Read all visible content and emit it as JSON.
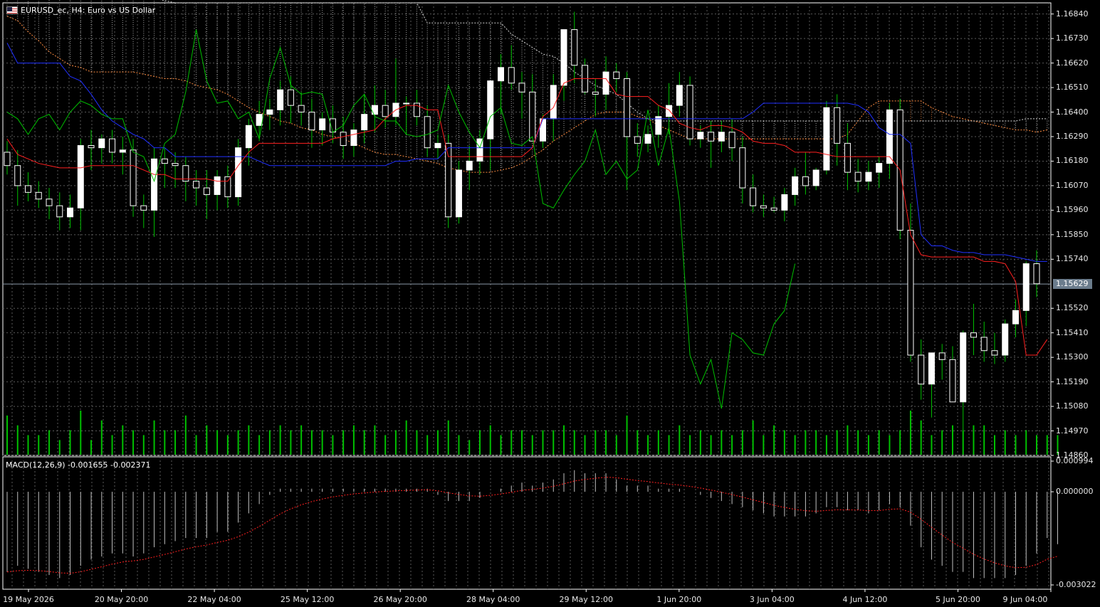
{
  "window": {
    "title": "EURUSD_ec, H4:  Euro vs US Dollar",
    "flag_icon": "us-eu-flag-icon"
  },
  "colors": {
    "background": "#000000",
    "grid": "#5a5a5a",
    "axis": "#ffffff",
    "bull_candle": "#ffffff",
    "bear_candle": "#000000",
    "wick": "#00c000",
    "tenkan": "#ff2020",
    "kijun": "#2030ff",
    "chikou": "#00c000",
    "span_a": "#ff8c40",
    "span_b": "#d8d8d8",
    "volume": "#00c000",
    "macd_hist": "#c0c0c0",
    "macd_signal": "#ff2020",
    "current_price_bg": "#6b7c8c"
  },
  "price_axis": {
    "labels": [
      "1.16840",
      "1.16730",
      "1.16620",
      "1.16510",
      "1.16400",
      "1.16290",
      "1.16180",
      "1.16070",
      "1.15960",
      "1.15850",
      "1.15740",
      "1.15520",
      "1.15410",
      "1.15300",
      "1.15190",
      "1.15080",
      "1.14970",
      "1.14860"
    ],
    "current_price": "1.15629"
  },
  "macd": {
    "label": "MACD(12,26,9) -0.001655 -0.002371",
    "axis_labels": [
      "0.000994",
      "0.000000",
      "-0.003022"
    ]
  },
  "time_axis": {
    "labels": [
      "19 May 2026",
      "20 May 20:00",
      "22 May 04:00",
      "25 May 12:00",
      "26 May 20:00",
      "28 May 04:00",
      "29 May 12:00",
      "1 Jun 20:00",
      "3 Jun 04:00",
      "4 Jun 12:00",
      "5 Jun 20:00",
      "9 Jun 04:00"
    ]
  },
  "chart_data": {
    "type": "candlestick",
    "symbol": "EURUSD_ec",
    "timeframe": "H4",
    "ylim": [
      1.1486,
      1.1689
    ],
    "macd_ylim": [
      -0.003022,
      0.000994
    ],
    "candles": [
      [
        1.1622,
        1.1627,
        1.1612,
        1.1616
      ],
      [
        1.1616,
        1.1623,
        1.1598,
        1.1607
      ],
      [
        1.1607,
        1.1613,
        1.16,
        1.1604
      ],
      [
        1.1604,
        1.1609,
        1.1597,
        1.1601
      ],
      [
        1.1601,
        1.1606,
        1.1592,
        1.1598
      ],
      [
        1.1598,
        1.1604,
        1.1587,
        1.1593
      ],
      [
        1.1593,
        1.1603,
        1.1588,
        1.1597
      ],
      [
        1.1597,
        1.1628,
        1.1587,
        1.1625
      ],
      [
        1.1625,
        1.1632,
        1.1614,
        1.1624
      ],
      [
        1.1624,
        1.163,
        1.1617,
        1.1628
      ],
      [
        1.1628,
        1.1632,
        1.1617,
        1.1622
      ],
      [
        1.1622,
        1.1629,
        1.1612,
        1.1623
      ],
      [
        1.1623,
        1.1628,
        1.1593,
        1.1598
      ],
      [
        1.1598,
        1.1603,
        1.1588,
        1.1596
      ],
      [
        1.1596,
        1.1624,
        1.1584,
        1.1619
      ],
      [
        1.1619,
        1.1624,
        1.1606,
        1.1617
      ],
      [
        1.1617,
        1.1622,
        1.1606,
        1.1616
      ],
      [
        1.1616,
        1.162,
        1.16,
        1.1609
      ],
      [
        1.1609,
        1.1614,
        1.1598,
        1.1606
      ],
      [
        1.1606,
        1.1614,
        1.1592,
        1.1603
      ],
      [
        1.1603,
        1.1614,
        1.1596,
        1.1611
      ],
      [
        1.1611,
        1.1616,
        1.1597,
        1.1602
      ],
      [
        1.1602,
        1.1628,
        1.1598,
        1.1624
      ],
      [
        1.1624,
        1.1637,
        1.1616,
        1.1634
      ],
      [
        1.1634,
        1.1645,
        1.1627,
        1.1639
      ],
      [
        1.1639,
        1.1646,
        1.1632,
        1.1641
      ],
      [
        1.1641,
        1.1654,
        1.1634,
        1.165
      ],
      [
        1.165,
        1.1656,
        1.1635,
        1.1643
      ],
      [
        1.1643,
        1.1649,
        1.1634,
        1.164
      ],
      [
        1.164,
        1.1646,
        1.1624,
        1.1632
      ],
      [
        1.1632,
        1.164,
        1.1625,
        1.1637
      ],
      [
        1.1637,
        1.1643,
        1.1626,
        1.1631
      ],
      [
        1.1631,
        1.1638,
        1.1619,
        1.1625
      ],
      [
        1.1625,
        1.1635,
        1.162,
        1.1632
      ],
      [
        1.1632,
        1.1648,
        1.1626,
        1.1639
      ],
      [
        1.1639,
        1.1652,
        1.1631,
        1.1643
      ],
      [
        1.1643,
        1.165,
        1.1633,
        1.1638
      ],
      [
        1.1638,
        1.1664,
        1.1634,
        1.1644
      ],
      [
        1.1644,
        1.1647,
        1.163,
        1.1644
      ],
      [
        1.1644,
        1.165,
        1.1634,
        1.1638
      ],
      [
        1.1638,
        1.1643,
        1.162,
        1.1624
      ],
      [
        1.1624,
        1.163,
        1.1619,
        1.1626
      ],
      [
        1.1626,
        1.163,
        1.1588,
        1.1593
      ],
      [
        1.1593,
        1.1618,
        1.159,
        1.1614
      ],
      [
        1.1614,
        1.1625,
        1.1605,
        1.1618
      ],
      [
        1.1618,
        1.1632,
        1.1612,
        1.1628
      ],
      [
        1.1628,
        1.1638,
        1.1614,
        1.1654
      ],
      [
        1.1654,
        1.1666,
        1.1639,
        1.166
      ],
      [
        1.166,
        1.167,
        1.165,
        1.1653
      ],
      [
        1.1653,
        1.1658,
        1.1637,
        1.1649
      ],
      [
        1.1649,
        1.1657,
        1.1637,
        1.1627
      ],
      [
        1.1627,
        1.1639,
        1.1624,
        1.1637
      ],
      [
        1.1637,
        1.1657,
        1.1627,
        1.1652
      ],
      [
        1.1652,
        1.1669,
        1.1645,
        1.1677
      ],
      [
        1.1677,
        1.1685,
        1.1653,
        1.1661
      ],
      [
        1.1661,
        1.1664,
        1.1648,
        1.1649
      ],
      [
        1.1649,
        1.1655,
        1.1638,
        1.1648
      ],
      [
        1.1648,
        1.1665,
        1.1641,
        1.1658
      ],
      [
        1.1658,
        1.1662,
        1.1649,
        1.1655
      ],
      [
        1.1655,
        1.1658,
        1.1605,
        1.1629
      ],
      [
        1.1629,
        1.1635,
        1.162,
        1.1626
      ],
      [
        1.1626,
        1.1634,
        1.1622,
        1.163
      ],
      [
        1.163,
        1.1643,
        1.1624,
        1.1638
      ],
      [
        1.1638,
        1.1653,
        1.163,
        1.1643
      ],
      [
        1.1643,
        1.1658,
        1.1638,
        1.1652
      ],
      [
        1.1652,
        1.1656,
        1.1625,
        1.1628
      ],
      [
        1.1628,
        1.1634,
        1.1624,
        1.1631
      ],
      [
        1.1631,
        1.1636,
        1.1615,
        1.1627
      ],
      [
        1.1627,
        1.1636,
        1.1622,
        1.1631
      ],
      [
        1.1631,
        1.1637,
        1.1618,
        1.1624
      ],
      [
        1.1624,
        1.1629,
        1.1599,
        1.1606
      ],
      [
        1.1606,
        1.1612,
        1.1595,
        1.1598
      ],
      [
        1.1598,
        1.1603,
        1.1593,
        1.1597
      ],
      [
        1.1597,
        1.1602,
        1.1595,
        1.1596
      ],
      [
        1.1596,
        1.1606,
        1.1591,
        1.1603
      ],
      [
        1.1603,
        1.1615,
        1.1598,
        1.1611
      ],
      [
        1.1611,
        1.1622,
        1.1603,
        1.1607
      ],
      [
        1.1607,
        1.1615,
        1.1605,
        1.1614
      ],
      [
        1.1614,
        1.1645,
        1.1612,
        1.1642
      ],
      [
        1.1642,
        1.1648,
        1.1616,
        1.1626
      ],
      [
        1.1626,
        1.1635,
        1.1605,
        1.1613
      ],
      [
        1.1613,
        1.1619,
        1.1604,
        1.1609
      ],
      [
        1.1609,
        1.1618,
        1.1605,
        1.1613
      ],
      [
        1.1613,
        1.162,
        1.1606,
        1.1617
      ],
      [
        1.1617,
        1.1644,
        1.161,
        1.1641
      ],
      [
        1.1641,
        1.1646,
        1.1583,
        1.1587
      ],
      [
        1.1587,
        1.1599,
        1.1528,
        1.1531
      ],
      [
        1.1531,
        1.1538,
        1.1511,
        1.1518
      ],
      [
        1.1518,
        1.1531,
        1.1503,
        1.1532
      ],
      [
        1.1532,
        1.1536,
        1.152,
        1.1529
      ],
      [
        1.1529,
        1.1535,
        1.151,
        1.151
      ],
      [
        1.151,
        1.1542,
        1.1497,
        1.1541
      ],
      [
        1.1541,
        1.1554,
        1.1531,
        1.1539
      ],
      [
        1.1539,
        1.1546,
        1.1528,
        1.1533
      ],
      [
        1.1533,
        1.1541,
        1.1527,
        1.1531
      ],
      [
        1.1531,
        1.1547,
        1.1528,
        1.1545
      ],
      [
        1.1545,
        1.1556,
        1.1539,
        1.1551
      ],
      [
        1.1551,
        1.1573,
        1.1544,
        1.1572
      ],
      [
        1.1572,
        1.1578,
        1.1557,
        1.1563
      ]
    ],
    "volumes": [
      8,
      6,
      4,
      4,
      5,
      3,
      5,
      9,
      3,
      7,
      4,
      6,
      5,
      4,
      7,
      5,
      5,
      8,
      4,
      6,
      5,
      4,
      5,
      6,
      4,
      5,
      6,
      5,
      6,
      5,
      5,
      4,
      5,
      6,
      5,
      6,
      4,
      5,
      7,
      5,
      4,
      5,
      7,
      4,
      3,
      5,
      6,
      4,
      5,
      5,
      4,
      5,
      5,
      6,
      5,
      4,
      5,
      5,
      4,
      8,
      5,
      4,
      5,
      4,
      6,
      4,
      5,
      4,
      5,
      4,
      5,
      7,
      4,
      6,
      5,
      4,
      5,
      5,
      4,
      5,
      6,
      5,
      4,
      5,
      4,
      5,
      9,
      7,
      4,
      5,
      6,
      5,
      6,
      6,
      4,
      5,
      4,
      5,
      4,
      4,
      4
    ],
    "macd_hist": [
      -0.0026,
      -0.0024,
      -0.0025,
      -0.0026,
      -0.0027,
      -0.0028,
      -0.0027,
      -0.0024,
      -0.0022,
      -0.0021,
      -0.002,
      -0.002,
      -0.0021,
      -0.002,
      -0.0018,
      -0.0017,
      -0.0016,
      -0.0015,
      -0.0015,
      -0.0015,
      -0.0013,
      -0.0013,
      -0.001,
      -0.0007,
      -0.0004,
      -0.0001,
      0.0001,
      0.0001,
      0.0001,
      0.0001,
      0.0001,
      0.0001,
      0.0001,
      0.0001,
      0.0001,
      0.0001,
      0.0001,
      0.0001,
      0.0001,
      0.0001,
      0.0001,
      -0.0001,
      -0.0003,
      -0.0003,
      -0.0003,
      -0.0002,
      0.0,
      0.0001,
      0.0002,
      0.0003,
      0.0002,
      0.0003,
      0.0004,
      0.0006,
      0.0007,
      0.0006,
      0.0006,
      0.0006,
      0.0004,
      0.0002,
      0.0002,
      0.0002,
      0.0001,
      0.0001,
      0.0001,
      0.0,
      -0.0001,
      -0.0002,
      -0.0003,
      -0.0004,
      -0.0005,
      -0.0006,
      -0.0007,
      -0.0008,
      -0.0008,
      -0.0008,
      -0.0008,
      -0.0007,
      -0.0005,
      -0.0005,
      -0.0006,
      -0.0006,
      -0.0007,
      -0.0006,
      -0.0004,
      -0.0005,
      -0.0011,
      -0.0018,
      -0.0022,
      -0.0024,
      -0.0026,
      -0.0026,
      -0.0028,
      -0.0028,
      -0.0028,
      -0.0028,
      -0.0027,
      -0.0024,
      -0.002,
      -0.0015,
      -0.0017
    ],
    "tenkan": [
      1.1628,
      1.1621,
      1.1619,
      1.1617,
      1.1616,
      1.1615,
      1.1615,
      1.1615,
      1.1616,
      1.1616,
      1.1616,
      1.1616,
      1.1616,
      1.1614,
      1.1612,
      1.1612,
      1.161,
      1.161,
      1.161,
      1.161,
      1.1609,
      1.1609,
      1.1616,
      1.1622,
      1.1626,
      1.1626,
      1.1626,
      1.1626,
      1.1626,
      1.1626,
      1.1626,
      1.1628,
      1.1629,
      1.163,
      1.1631,
      1.1632,
      1.1637,
      1.1641,
      1.1643,
      1.1643,
      1.1641,
      1.1641,
      1.162,
      1.162,
      1.162,
      1.162,
      1.162,
      1.162,
      1.162,
      1.162,
      1.1624,
      1.1638,
      1.1642,
      1.1653,
      1.1655,
      1.1655,
      1.1655,
      1.1655,
      1.1648,
      1.1647,
      1.1647,
      1.1647,
      1.1643,
      1.1641,
      1.1635,
      1.1633,
      1.1632,
      1.1634,
      1.1634,
      1.1633,
      1.1631,
      1.1627,
      1.1626,
      1.1626,
      1.1625,
      1.1622,
      1.1622,
      1.1622,
      1.1621,
      1.162,
      1.162,
      1.162,
      1.162,
      1.162,
      1.162,
      1.1614,
      1.1585,
      1.1576,
      1.1575,
      1.1575,
      1.1575,
      1.1575,
      1.1575,
      1.1573,
      1.1573,
      1.1572,
      1.1564,
      1.1531,
      1.1531,
      1.1538,
      1.154
    ],
    "kijun": [
      1.1671,
      1.1662,
      1.1662,
      1.1662,
      1.1662,
      1.1662,
      1.1656,
      1.1654,
      1.1648,
      1.1641,
      1.1636,
      1.1633,
      1.163,
      1.1628,
      1.1624,
      1.1624,
      1.162,
      1.162,
      1.162,
      1.162,
      1.162,
      1.162,
      1.162,
      1.162,
      1.1618,
      1.1616,
      1.1616,
      1.1616,
      1.1616,
      1.1616,
      1.1616,
      1.1616,
      1.1616,
      1.1616,
      1.1616,
      1.1616,
      1.1616,
      1.1618,
      1.1618,
      1.1619,
      1.1619,
      1.1619,
      1.1624,
      1.1624,
      1.1624,
      1.1624,
      1.1624,
      1.1624,
      1.1624,
      1.1624,
      1.1624,
      1.1637,
      1.1637,
      1.1637,
      1.1637,
      1.1637,
      1.1637,
      1.1637,
      1.1637,
      1.1637,
      1.1637,
      1.1637,
      1.1637,
      1.1637,
      1.1637,
      1.1637,
      1.1637,
      1.1637,
      1.1637,
      1.1637,
      1.1637,
      1.164,
      1.1644,
      1.1644,
      1.1644,
      1.1644,
      1.1644,
      1.1644,
      1.1644,
      1.1644,
      1.1644,
      1.1643,
      1.164,
      1.1633,
      1.163,
      1.163,
      1.1626,
      1.1585,
      1.158,
      1.158,
      1.1578,
      1.1577,
      1.1577,
      1.1576,
      1.1576,
      1.1576,
      1.1575,
      1.1574,
      1.1573,
      1.1573,
      1.1573,
      1.1573
    ],
    "chikou": [
      1.164,
      1.1637,
      1.163,
      1.1637,
      1.1639,
      1.1632,
      1.164,
      1.1645,
      1.1643,
      1.1639,
      1.1637,
      1.1637,
      1.1622,
      1.162,
      1.1609,
      1.1626,
      1.163,
      1.1649,
      1.1677,
      1.1654,
      1.1644,
      1.1645,
      1.1637,
      1.164,
      1.1628,
      1.1655,
      1.1669,
      1.1652,
      1.1648,
      1.1649,
      1.1648,
      1.1631,
      1.1634,
      1.1643,
      1.1648,
      1.1638,
      1.1636,
      1.1636,
      1.163,
      1.1629,
      1.163,
      1.1632,
      1.1652,
      1.164,
      1.1631,
      1.1624,
      1.1638,
      1.1642,
      1.1626,
      1.1625,
      1.1629,
      1.1599,
      1.1597,
      1.1605,
      1.1612,
      1.1618,
      1.1632,
      1.1612,
      1.1618,
      1.161,
      1.1614,
      1.1641,
      1.1616,
      1.1633,
      1.16,
      1.1531,
      1.1518,
      1.1529,
      1.1507,
      1.1541,
      1.1538,
      1.1532,
      1.1531,
      1.1545,
      1.1551,
      1.1572
    ],
    "span_a": [
      1.1683,
      1.1681,
      1.1676,
      1.1672,
      1.1667,
      1.1664,
      1.1661,
      1.166,
      1.1658,
      1.1658,
      1.1658,
      1.1658,
      1.1658,
      1.1657,
      1.1656,
      1.1655,
      1.1655,
      1.1654,
      1.1652,
      1.1651,
      1.165,
      1.1648,
      1.1645,
      1.1642,
      1.164,
      1.1638,
      1.1636,
      1.1635,
      1.1633,
      1.1632,
      1.163,
      1.1629,
      1.1628,
      1.1626,
      1.1624,
      1.1622,
      1.1621,
      1.1621,
      1.162,
      1.1619,
      1.1618,
      1.1617,
      1.1615,
      1.1614,
      1.1613,
      1.1613,
      1.1613,
      1.1614,
      1.1615,
      1.1617,
      1.162,
      1.1623,
      1.1627,
      1.163,
      1.1633,
      1.1636,
      1.1639,
      1.164,
      1.164,
      1.164,
      1.1638,
      1.1637,
      1.1634,
      1.1632,
      1.163,
      1.1628,
      1.1628,
      1.1628,
      1.1628,
      1.1628,
      1.1628,
      1.1628,
      1.1628,
      1.1628,
      1.1628,
      1.1628,
      1.1628,
      1.1628,
      1.1628,
      1.1628,
      1.163,
      1.1636,
      1.1642,
      1.1645,
      1.1645,
      1.1645,
      1.1645,
      1.1645,
      1.1642,
      1.164,
      1.1638,
      1.1637,
      1.1636,
      1.1635,
      1.1634,
      1.1633,
      1.1632,
      1.1632,
      1.1631,
      1.1632,
      1.1634
    ],
    "span_b": [
      1.1695,
      1.1695,
      1.1695,
      1.1695,
      1.1695,
      1.1695,
      1.1695,
      1.1695,
      1.1695,
      1.1695,
      1.1695,
      1.1695,
      1.1693,
      1.1692,
      1.1691,
      1.169,
      1.1689,
      1.1689,
      1.1689,
      1.1689,
      1.1689,
      1.1689,
      1.1689,
      1.1689,
      1.1689,
      1.1689,
      1.1689,
      1.1689,
      1.1689,
      1.1689,
      1.1689,
      1.1689,
      1.1689,
      1.1689,
      1.1689,
      1.1689,
      1.1689,
      1.1689,
      1.1689,
      1.1689,
      1.168,
      1.168,
      1.168,
      1.168,
      1.168,
      1.168,
      1.168,
      1.168,
      1.1675,
      1.1672,
      1.1669,
      1.1666,
      1.1665,
      1.1662,
      1.1658,
      1.1655,
      1.1652,
      1.165,
      1.1648,
      1.1644,
      1.164,
      1.1637,
      1.1636,
      1.1636,
      1.1636,
      1.1636,
      1.1636,
      1.1636,
      1.1636,
      1.1636,
      1.1636,
      1.1636,
      1.1636,
      1.1636,
      1.1636,
      1.1636,
      1.1636,
      1.1636,
      1.1636,
      1.1636,
      1.1636,
      1.1636,
      1.1636,
      1.1636,
      1.1636,
      1.1636,
      1.1636,
      1.1636,
      1.1636,
      1.1636,
      1.1636,
      1.1636,
      1.1636,
      1.1636,
      1.1636,
      1.1636,
      1.1636,
      1.1637,
      1.1637,
      1.1637,
      1.1637
    ]
  }
}
